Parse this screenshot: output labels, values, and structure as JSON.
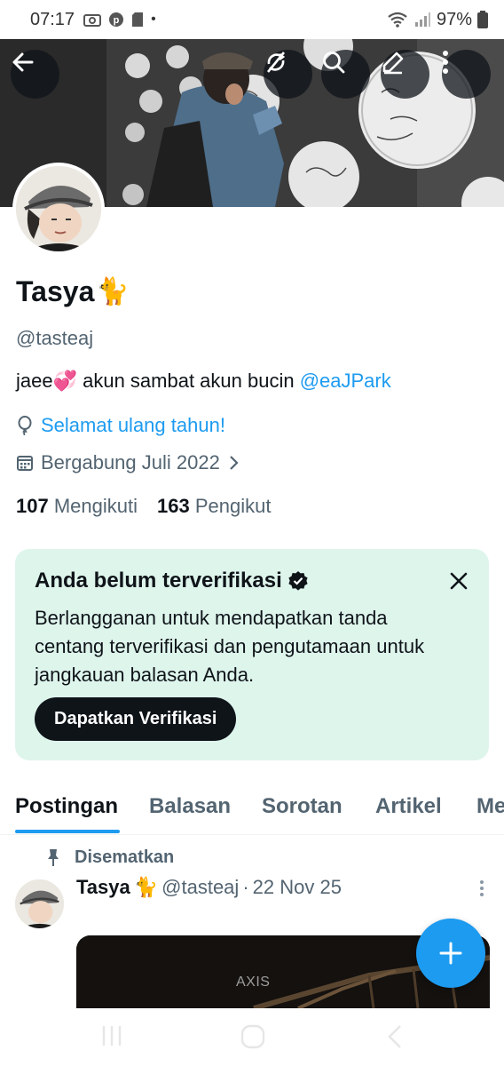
{
  "status_bar": {
    "time": "07:17",
    "battery": "97%",
    "dot": "•"
  },
  "profile": {
    "display_name": "Tasya",
    "name_emoji": "🐈",
    "handle": "@tasteaj",
    "bio_text": "jaee💞 akun sambat akun bucin ",
    "bio_mention": "@eaJPark",
    "birthday": "Selamat ulang tahun!",
    "joined": "Bergabung Juli 2022",
    "following_count": "107",
    "following_label": "Mengikuti",
    "followers_count": "163",
    "followers_label": "Pengikut"
  },
  "verify_card": {
    "title": "Anda belum terverifikasi",
    "body": "Berlangganan untuk mendapatkan tanda centang terverifikasi dan pengutamaan untuk jangkauan balasan Anda.",
    "button": "Dapatkan Verifikasi"
  },
  "tabs": [
    {
      "label": "Postingan",
      "active": true
    },
    {
      "label": "Balasan",
      "active": false
    },
    {
      "label": "Sorotan",
      "active": false
    },
    {
      "label": "Artikel",
      "active": false
    },
    {
      "label": "Me",
      "active": false
    }
  ],
  "post": {
    "pinned_label": "Disematkan",
    "author_name": "Tasya",
    "author_emoji": "🐈",
    "author_handle": "@tasteaj",
    "separator": "·",
    "date": "22 Nov 25",
    "media_text": "AXIS"
  },
  "icons": {
    "back": "arrow-left-icon",
    "refresh": "no-sync-icon",
    "search": "search-icon",
    "edit": "edit-icon",
    "more": "more-vertical-icon",
    "birthday": "balloon-icon",
    "calendar": "calendar-icon",
    "verified": "verified-badge-icon",
    "pin": "pin-icon",
    "compose": "plus-icon"
  },
  "colors": {
    "accent": "#1d9bf0",
    "verify_bg": "#def5ec",
    "text_primary": "#0f1419",
    "text_secondary": "#536471"
  }
}
